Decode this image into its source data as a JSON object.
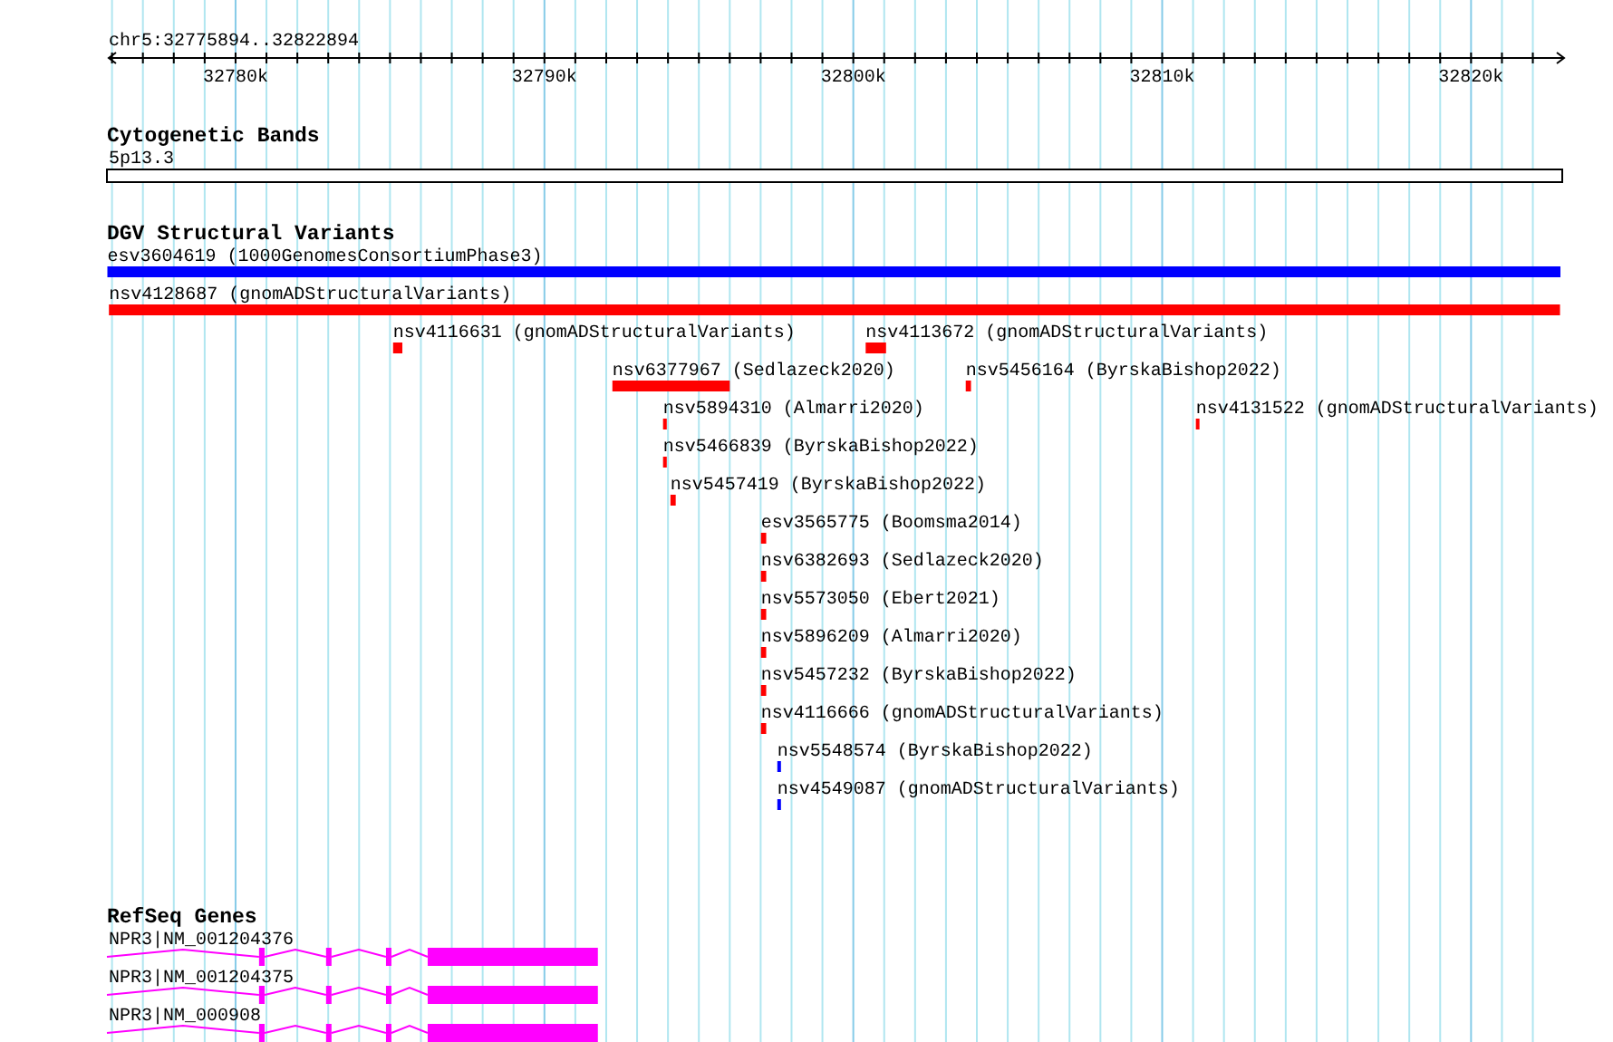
{
  "view": {
    "title": "chr5:32775894..32822894",
    "tick_labels": [
      "32780k",
      "32790k",
      "32800k",
      "32810k",
      "32820k"
    ]
  },
  "tracks": [
    {
      "kind": "bands",
      "title": "Cytogenetic Bands",
      "bands": [
        {
          "name": "5p13.3"
        }
      ]
    },
    {
      "kind": "variants",
      "title": "DGV Structural Variants",
      "features": [
        {
          "label": "esv3604619 (1000GenomesConsortiumPhase3)",
          "color": "#0000ff"
        },
        {
          "label": "nsv4128687 (gnomADStructuralVariants)",
          "color": "#ff0000"
        },
        {
          "label": "nsv4116631 (gnomADStructuralVariants)",
          "color": "#ff0000"
        },
        {
          "label": "nsv4113672 (gnomADStructuralVariants)",
          "color": "#ff0000"
        },
        {
          "label": "nsv6377967 (Sedlazeck2020)",
          "color": "#ff0000"
        },
        {
          "label": "nsv5456164 (ByrskaBishop2022)",
          "color": "#ff0000"
        },
        {
          "label": "nsv5894310 (Almarri2020)",
          "color": "#ff0000"
        },
        {
          "label": "nsv4131522 (gnomADStructuralVariants)",
          "color": "#ff0000"
        },
        {
          "label": "nsv5466839 (ByrskaBishop2022)",
          "color": "#ff0000"
        },
        {
          "label": "nsv5457419 (ByrskaBishop2022)",
          "color": "#ff0000"
        },
        {
          "label": "esv3565775 (Boomsma2014)",
          "color": "#ff0000"
        },
        {
          "label": "nsv6382693 (Sedlazeck2020)",
          "color": "#ff0000"
        },
        {
          "label": "nsv5573050 (Ebert2021)",
          "color": "#ff0000"
        },
        {
          "label": "nsv5896209 (Almarri2020)",
          "color": "#ff0000"
        },
        {
          "label": "nsv5457232 (ByrskaBishop2022)",
          "color": "#ff0000"
        },
        {
          "label": "nsv4116666 (gnomADStructuralVariants)",
          "color": "#ff0000"
        },
        {
          "label": "nsv5548574 (ByrskaBishop2022)",
          "color": "#0000ff"
        },
        {
          "label": "nsv4549087 (gnomADStructuralVariants)",
          "color": "#0000ff"
        }
      ]
    },
    {
      "kind": "genes",
      "title": "RefSeq Genes",
      "transcripts": [
        {
          "label": "NPR3|NM_001204376"
        },
        {
          "label": "NPR3|NM_001204375"
        },
        {
          "label": "NPR3|NM_000908"
        }
      ]
    }
  ]
}
